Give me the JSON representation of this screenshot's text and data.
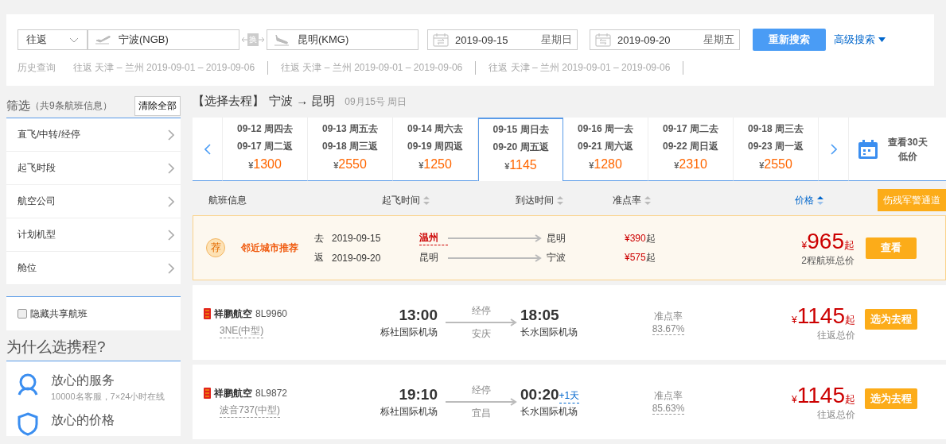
{
  "search": {
    "trip_type": "往返",
    "from": "宁波(NGB)",
    "swap": "换",
    "to": "昆明(KMG)",
    "depart_date": "2019-09-15",
    "depart_weekday": "星期日",
    "return_date": "2019-09-20",
    "return_weekday": "星期五",
    "search_button": "重新搜索",
    "advanced": "高级搜索"
  },
  "history": {
    "label": "历史查询",
    "items": [
      "往返 天津 – 兰州 2019-09-01 – 2019-09-06",
      "往返 天津 – 兰州 2019-09-01 – 2019-09-06",
      "往返 天津 – 兰州 2019-09-01 – 2019-09-06"
    ]
  },
  "filter": {
    "title": "筛选",
    "count": "（共9条航班信息）",
    "clear": "清除全部",
    "items": [
      "直飞/中转/经停",
      "起飞时段",
      "航空公司",
      "计划机型",
      "舱位"
    ],
    "hide_shared": {
      "label": "隐藏共享航班",
      "checked": false
    }
  },
  "why": {
    "title": "为什么选携程?",
    "features": [
      {
        "kind": "service",
        "title": "放心的服务",
        "desc": "10000名客服，7×24小时在线"
      },
      {
        "kind": "price",
        "title": "放心的价格"
      }
    ]
  },
  "results": {
    "heading": {
      "step": "【选择去程】",
      "route": "宁波 → 昆明",
      "date": "09月15号 周日"
    },
    "dates": [
      {
        "depart": "09-12 周四去",
        "return": "09-17 周二返",
        "currency": "¥",
        "price": "1300",
        "selected": false
      },
      {
        "depart": "09-13 周五去",
        "return": "09-18 周三返",
        "currency": "¥",
        "price": "2550",
        "selected": false
      },
      {
        "depart": "09-14 周六去",
        "return": "09-19 周四返",
        "currency": "¥",
        "price": "1250",
        "selected": false
      },
      {
        "depart": "09-15 周日去",
        "return": "09-20 周五返",
        "currency": "¥",
        "price": "1145",
        "selected": true
      },
      {
        "depart": "09-16 周一去",
        "return": "09-21 周六返",
        "currency": "¥",
        "price": "1280",
        "selected": false
      },
      {
        "depart": "09-17 周二去",
        "return": "09-22 周日返",
        "currency": "¥",
        "price": "2310",
        "selected": false
      },
      {
        "depart": "09-18 周三去",
        "return": "09-23 周一返",
        "currency": "¥",
        "price": "2550",
        "selected": false
      }
    ],
    "calendar_link": "查看30天低价",
    "columns": [
      {
        "label": "航班信息",
        "sortable": false,
        "active": false
      },
      {
        "label": "起飞时间",
        "sortable": true,
        "active": false
      },
      {
        "label": "到达时间",
        "sortable": true,
        "active": false
      },
      {
        "label": "准点率",
        "sortable": true,
        "active": false
      },
      {
        "label": "价格",
        "sortable": true,
        "active": true
      }
    ],
    "priority_button": "伤残军警通道",
    "recommend": {
      "badge": "荐",
      "label": "邻近城市推荐",
      "legs": [
        {
          "dir": "去",
          "date": "2019-09-15",
          "from": "温州",
          "highlight": true,
          "to": "昆明",
          "price": "¥390",
          "suffix": "起"
        },
        {
          "dir": "返",
          "date": "2019-09-20",
          "from": "昆明",
          "highlight": false,
          "to": "宁波",
          "price": "¥575",
          "suffix": "起"
        }
      ],
      "currency": "¥",
      "total": "965",
      "suffix": "起",
      "note": "2程航班总价",
      "button": "查看"
    },
    "flights": [
      {
        "airline": "祥鹏航空",
        "flight_no": "8L9960",
        "aircraft": "3NE(中型)",
        "dep_time": "13:00",
        "dep_airport": "栎社国际机场",
        "stop_label": "经停",
        "stop_city": "安庆",
        "arr_time": "18:05",
        "arr_airport": "长水国际机场",
        "ontime_label": "准点率",
        "ontime": "83.67%",
        "currency": "¥",
        "price": "1145",
        "suffix": "起",
        "note": "往返总价",
        "button": "选为去程"
      },
      {
        "airline": "祥鹏航空",
        "flight_no": "8L9872",
        "aircraft": "波音737(中型)",
        "dep_time": "19:10",
        "dep_airport": "栎社国际机场",
        "stop_label": "经停",
        "stop_city": "宜昌",
        "arr_time": "00:20",
        "day_offset": "+1天",
        "arr_airport": "长水国际机场",
        "ontime_label": "准点率",
        "ontime": "85.63%",
        "currency": "¥",
        "price": "1145",
        "suffix": "起",
        "note": "往返总价",
        "button": "选为去程"
      }
    ]
  }
}
